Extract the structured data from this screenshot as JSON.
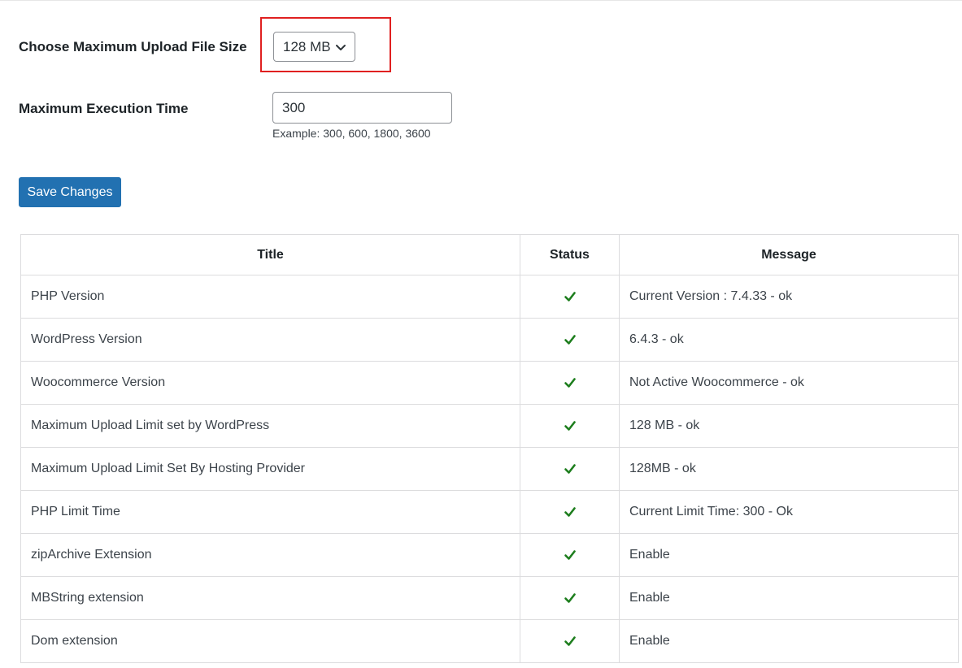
{
  "settings": {
    "upload_size_label": "Choose Maximum Upload File Size",
    "upload_size_value": "128 MB",
    "execution_time_label": "Maximum Execution Time",
    "execution_time_value": "300",
    "execution_time_hint": "Example: 300, 600, 1800, 3600",
    "save_label": "Save Changes"
  },
  "table": {
    "headers": {
      "title": "Title",
      "status": "Status",
      "message": "Message"
    },
    "rows": [
      {
        "title": "PHP Version",
        "status": "ok",
        "message": "Current Version : 7.4.33 - ok"
      },
      {
        "title": "WordPress Version",
        "status": "ok",
        "message": "6.4.3 - ok"
      },
      {
        "title": "Woocommerce Version",
        "status": "ok",
        "message": "Not Active Woocommerce - ok"
      },
      {
        "title": "Maximum Upload Limit set by WordPress",
        "status": "ok",
        "message": "128 MB - ok"
      },
      {
        "title": "Maximum Upload Limit Set By Hosting Provider",
        "status": "ok",
        "message": "128MB - ok"
      },
      {
        "title": "PHP Limit Time",
        "status": "ok",
        "message": "Current Limit Time: 300 - Ok"
      },
      {
        "title": "zipArchive Extension",
        "status": "ok",
        "message": "Enable"
      },
      {
        "title": "MBString extension",
        "status": "ok",
        "message": "Enable"
      },
      {
        "title": "Dom extension",
        "status": "ok",
        "message": "Enable"
      }
    ]
  },
  "colors": {
    "primary_button": "#2271b1",
    "highlight_border": "#e02020",
    "check_green": "#1e7e1e"
  },
  "icons": {
    "dropdown": "chevron-down-icon",
    "status_ok": "check-icon"
  }
}
